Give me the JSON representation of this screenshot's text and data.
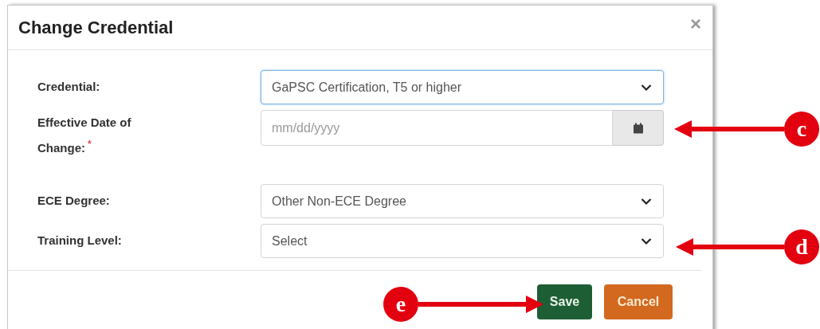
{
  "dialog": {
    "title": "Change Credential",
    "close": "×"
  },
  "fields": [
    {
      "kind": "select",
      "label": "Credential:",
      "value": "GaPSC Certification, T5 or higher",
      "focused": true
    },
    {
      "kind": "date",
      "label": "Effective Date of Change:",
      "required_mark": "*",
      "placeholder": "mm/dd/yyyy",
      "focused": false
    },
    {
      "kind": "select",
      "label": "ECE Degree:",
      "value": "Other Non-ECE Degree",
      "focused": false
    },
    {
      "kind": "select",
      "label": "Training Level:",
      "value": "Select",
      "focused": false
    }
  ],
  "buttons": [
    {
      "kind": "save",
      "label": "Save"
    },
    {
      "kind": "cancel",
      "label": "Cancel"
    }
  ],
  "callouts": [
    {
      "label": "c"
    },
    {
      "label": "d"
    },
    {
      "label": "e"
    }
  ]
}
